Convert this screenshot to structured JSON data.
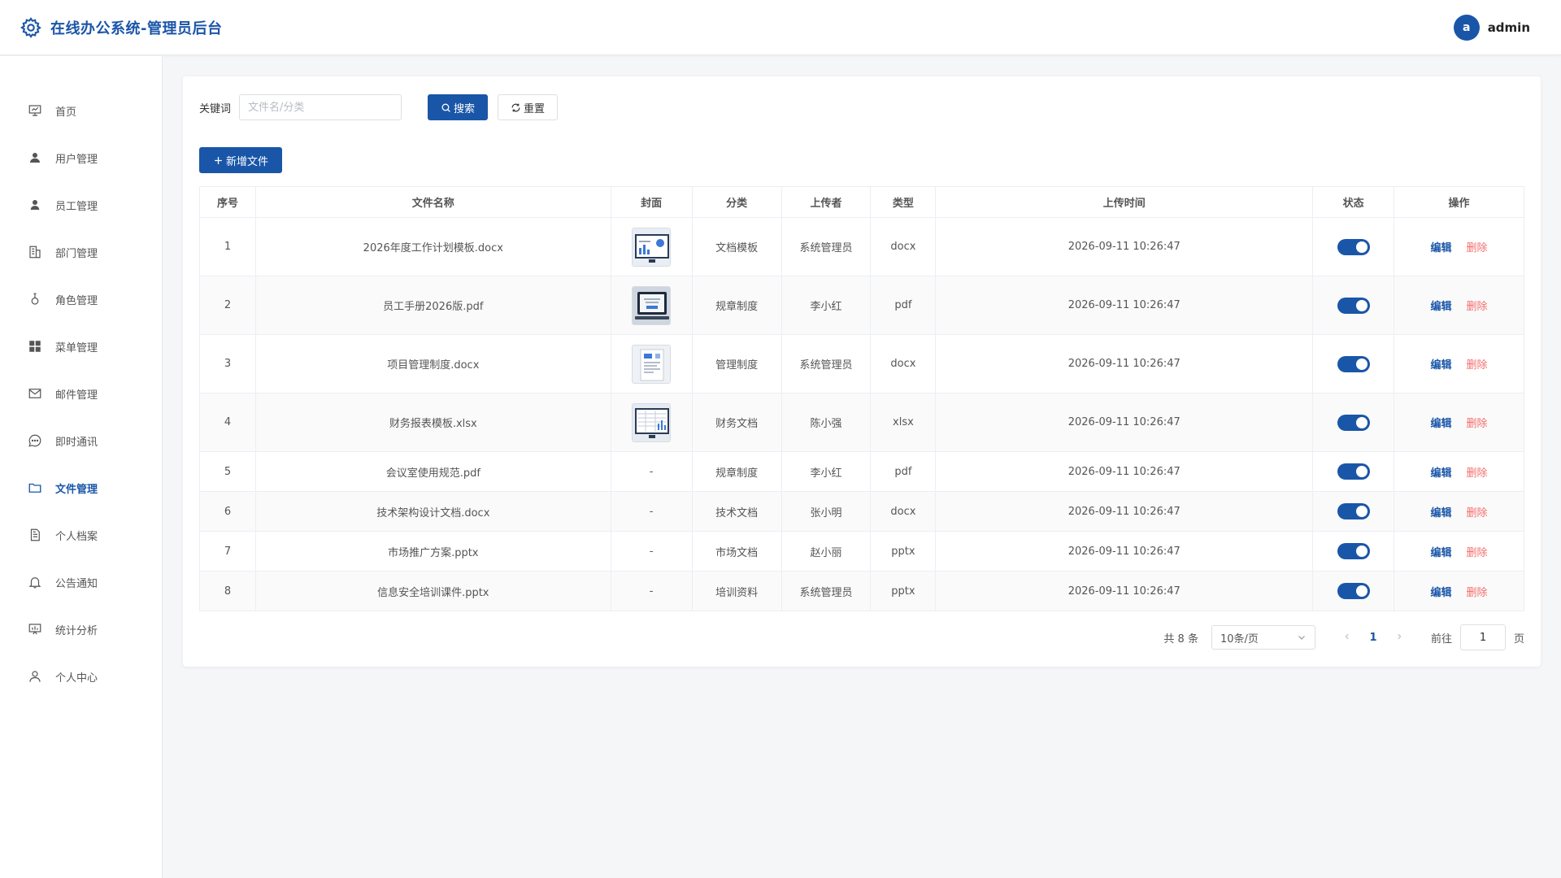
{
  "header": {
    "title": "在线办公系统-管理员后台",
    "avatar_letter": "a",
    "username": "admin"
  },
  "sidebar": {
    "items": [
      {
        "label": "首页",
        "icon": "presentation-icon"
      },
      {
        "label": "用户管理",
        "icon": "user-icon"
      },
      {
        "label": "员工管理",
        "icon": "user-icon"
      },
      {
        "label": "部门管理",
        "icon": "building-icon"
      },
      {
        "label": "角色管理",
        "icon": "stamp-icon"
      },
      {
        "label": "菜单管理",
        "icon": "grid-icon"
      },
      {
        "label": "邮件管理",
        "icon": "mail-icon"
      },
      {
        "label": "即时通讯",
        "icon": "chat-icon"
      },
      {
        "label": "文件管理",
        "icon": "folder-icon"
      },
      {
        "label": "个人档案",
        "icon": "document-icon"
      },
      {
        "label": "公告通知",
        "icon": "bell-icon"
      },
      {
        "label": "统计分析",
        "icon": "chart-board-icon"
      },
      {
        "label": "个人中心",
        "icon": "person-icon"
      }
    ],
    "active_index": 8
  },
  "search": {
    "label": "关键词",
    "placeholder": "文件名/分类",
    "value": "",
    "search_label": "搜索",
    "reset_label": "重置"
  },
  "toolbar": {
    "add_label": "新增文件"
  },
  "table": {
    "columns": [
      "序号",
      "文件名称",
      "封面",
      "分类",
      "上传者",
      "类型",
      "上传时间",
      "状态",
      "操作"
    ],
    "edit_label": "编辑",
    "delete_label": "删除",
    "empty_cover": "-",
    "rows": [
      {
        "no": "1",
        "name": "2026年度工作计划模板.docx",
        "cover": "image",
        "category": "文档模板",
        "uploader": "系统管理员",
        "type": "docx",
        "time": "2026-09-11 10:26:47",
        "enabled": true
      },
      {
        "no": "2",
        "name": "员工手册2026版.pdf",
        "cover": "image",
        "category": "规章制度",
        "uploader": "李小红",
        "type": "pdf",
        "time": "2026-09-11 10:26:47",
        "enabled": true
      },
      {
        "no": "3",
        "name": "项目管理制度.docx",
        "cover": "image",
        "category": "管理制度",
        "uploader": "系统管理员",
        "type": "docx",
        "time": "2026-09-11 10:26:47",
        "enabled": true
      },
      {
        "no": "4",
        "name": "财务报表模板.xlsx",
        "cover": "image",
        "category": "财务文档",
        "uploader": "陈小强",
        "type": "xlsx",
        "time": "2026-09-11 10:26:47",
        "enabled": true
      },
      {
        "no": "5",
        "name": "会议室使用规范.pdf",
        "cover": "-",
        "category": "规章制度",
        "uploader": "李小红",
        "type": "pdf",
        "time": "2026-09-11 10:26:47",
        "enabled": true
      },
      {
        "no": "6",
        "name": "技术架构设计文档.docx",
        "cover": "-",
        "category": "技术文档",
        "uploader": "张小明",
        "type": "docx",
        "time": "2026-09-11 10:26:47",
        "enabled": true
      },
      {
        "no": "7",
        "name": "市场推广方案.pptx",
        "cover": "-",
        "category": "市场文档",
        "uploader": "赵小丽",
        "type": "pptx",
        "time": "2026-09-11 10:26:47",
        "enabled": true
      },
      {
        "no": "8",
        "name": "信息安全培训课件.pptx",
        "cover": "-",
        "category": "培训资料",
        "uploader": "系统管理员",
        "type": "pptx",
        "time": "2026-09-11 10:26:47",
        "enabled": true
      }
    ]
  },
  "pagination": {
    "total_text": "共 8 条",
    "page_size": "10条/页",
    "current_page": "1",
    "goto_label": "前往",
    "goto_value": "1",
    "page_unit": "页"
  },
  "colors": {
    "primary": "#1a56a8",
    "danger": "#f56c6c"
  }
}
